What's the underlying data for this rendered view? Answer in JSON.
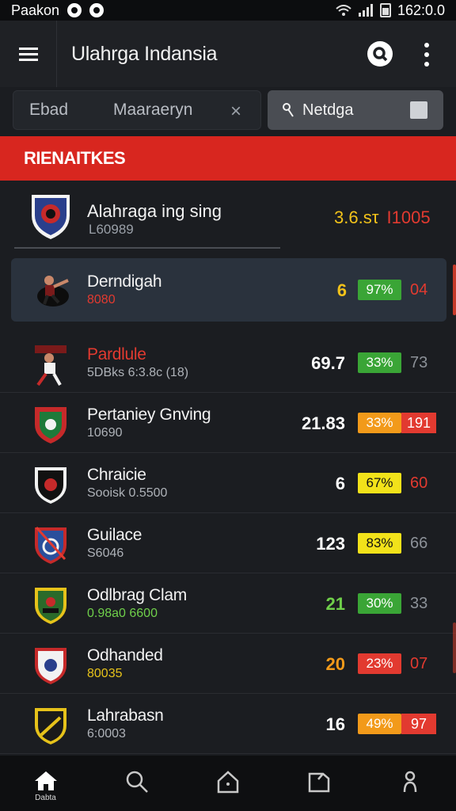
{
  "status": {
    "app": "Paakon",
    "time": "162:0.0"
  },
  "header": {
    "title": "Ulahrga Indansia"
  },
  "filters": {
    "seg_a": "Ebad",
    "seg_b": "Maaraeryn",
    "clear": "×",
    "select_label": "Netdga",
    "select_icon": "key"
  },
  "section": {
    "title": "RIENAITKES"
  },
  "featured": {
    "name": "Alahraga ing sing",
    "sub": "L60989",
    "odds_a": "3.6.sτ",
    "odds_b": "I1005"
  },
  "rows": [
    {
      "name": "Derndigah",
      "sub": "8080",
      "score": "6",
      "pct": "97%",
      "tail": "04"
    },
    {
      "name": "Pardlule",
      "sub": "5DBks 6:3.8c (18)",
      "score": "69.7",
      "pct": "33%",
      "tail": "73"
    },
    {
      "name": "Pertaniey Gnving",
      "sub": "10690",
      "score": "21.83",
      "pct": "33%",
      "tail": "191"
    },
    {
      "name": "Chraicie",
      "sub": "Sooisk 0.5500",
      "score": "6",
      "pct": "67%",
      "tail": "60"
    },
    {
      "name": "Guilace",
      "sub": "S6046",
      "score": "123",
      "pct": "83%",
      "tail": "66"
    },
    {
      "name": "Odlbrag Clam",
      "sub": "0.98a0 6600",
      "score": "21",
      "pct": "30%",
      "tail": "33"
    },
    {
      "name": "Odhanded",
      "sub": "80035",
      "score": "20",
      "pct": "23%",
      "tail": "07"
    },
    {
      "name": "Lahrabasn",
      "sub": "6:0003",
      "score": "16",
      "pct": "49%",
      "tail": "97"
    }
  ],
  "nav": {
    "home_label": "Dabta"
  },
  "colors": {
    "accent_red": "#d8261f",
    "green": "#3aa536",
    "yellow": "#f2e21a",
    "orange": "#f29a1a"
  }
}
